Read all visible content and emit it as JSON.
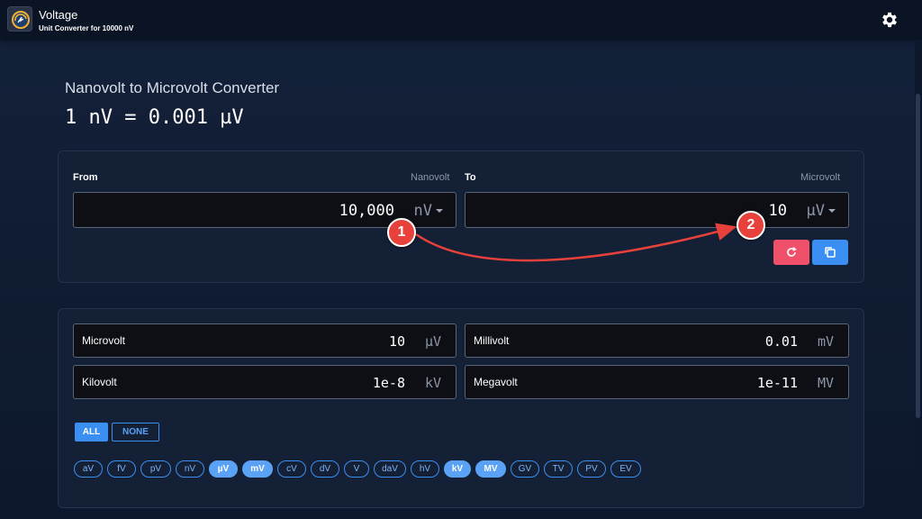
{
  "app": {
    "title": "Voltage",
    "subtitle": "Unit Converter for 10000 nV",
    "icon": "voltage-meter-icon",
    "settings_icon": "gear-icon"
  },
  "page": {
    "title": "Nanovolt to Microvolt Converter",
    "formula": "1 nV = 0.001 µV"
  },
  "converter": {
    "from_label": "From",
    "from_unit_name": "Nanovolt",
    "from_value": "10,000",
    "from_unit": "nV",
    "to_label": "To",
    "to_unit_name": "Microvolt",
    "to_value": "10",
    "to_unit": "µV",
    "reset_icon": "refresh-icon",
    "copy_icon": "copy-icon"
  },
  "results": [
    {
      "name": "Microvolt",
      "value": "10",
      "unit": "µV"
    },
    {
      "name": "Millivolt",
      "value": "0.01",
      "unit": "mV"
    },
    {
      "name": "Kilovolt",
      "value": "1e-8",
      "unit": "kV"
    },
    {
      "name": "Megavolt",
      "value": "1e-11",
      "unit": "MV"
    }
  ],
  "filter": {
    "all_label": "ALL",
    "none_label": "NONE",
    "units": [
      {
        "label": "aV",
        "active": false
      },
      {
        "label": "fV",
        "active": false
      },
      {
        "label": "pV",
        "active": false
      },
      {
        "label": "nV",
        "active": false
      },
      {
        "label": "µV",
        "active": true
      },
      {
        "label": "mV",
        "active": true
      },
      {
        "label": "cV",
        "active": false
      },
      {
        "label": "dV",
        "active": false
      },
      {
        "label": "V",
        "active": false
      },
      {
        "label": "daV",
        "active": false
      },
      {
        "label": "hV",
        "active": false
      },
      {
        "label": "kV",
        "active": true
      },
      {
        "label": "MV",
        "active": true
      },
      {
        "label": "GV",
        "active": false
      },
      {
        "label": "TV",
        "active": false
      },
      {
        "label": "PV",
        "active": false
      },
      {
        "label": "EV",
        "active": false
      }
    ]
  },
  "annotations": [
    {
      "number": "1"
    },
    {
      "number": "2"
    }
  ],
  "colors": {
    "accent_blue": "#3b8ff2",
    "reset_red": "#f0506a",
    "annotation_red": "#e8413c"
  }
}
